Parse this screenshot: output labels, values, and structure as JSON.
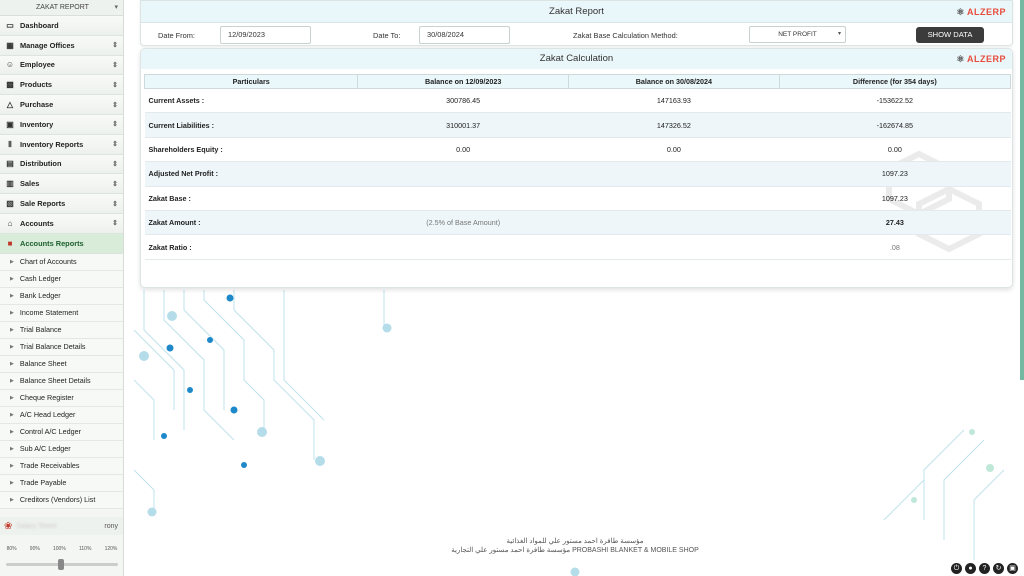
{
  "sidebar": {
    "title": "ZAKAT REPORT",
    "menu": [
      {
        "label": "Dashboard",
        "icon": "monitor-icon",
        "glyph": "▭",
        "arrow": ""
      },
      {
        "label": "Manage Offices",
        "icon": "building-icon",
        "glyph": "▦",
        "arrow": "⇕"
      },
      {
        "label": "Employee",
        "icon": "users-icon",
        "glyph": "☺",
        "arrow": "⇕"
      },
      {
        "label": "Products",
        "icon": "grid-icon",
        "glyph": "▩",
        "arrow": "⇕"
      },
      {
        "label": "Purchase",
        "icon": "cart-icon",
        "glyph": "△",
        "arrow": "⇕"
      },
      {
        "label": "Inventory",
        "icon": "box-icon",
        "glyph": "▣",
        "arrow": "⇕"
      },
      {
        "label": "Inventory Reports",
        "icon": "bar-chart-icon",
        "glyph": "Ⅱ",
        "arrow": "⇕"
      },
      {
        "label": "Distribution",
        "icon": "book-icon",
        "glyph": "▤",
        "arrow": "⇕"
      },
      {
        "label": "Sales",
        "icon": "register-icon",
        "glyph": "▥",
        "arrow": "⇕"
      },
      {
        "label": "Sale Reports",
        "icon": "report-icon",
        "glyph": "▧",
        "arrow": "⇕"
      },
      {
        "label": "Accounts",
        "icon": "bank-icon",
        "glyph": "⌂",
        "arrow": "⇕"
      },
      {
        "label": "Accounts Reports",
        "icon": "accounts-report-icon",
        "glyph": "■",
        "arrow": ""
      }
    ],
    "submenu": [
      "Chart of Accounts",
      "Cash Ledger",
      "Bank Ledger",
      "Income Statement",
      "Trial Balance",
      "Trial Balance Details",
      "Balance Sheet",
      "Balance Sheet Details",
      "Cheque Register",
      "A/C Head Ledger",
      "Control A/C Ledger",
      "Sub A/C Ledger",
      "Trade Receivables",
      "Trade Payable",
      "Creditors (Vendors) List"
    ],
    "user_name": "Salary Sheet",
    "user_right": "rony",
    "zoom_levels": [
      "80%",
      "90%",
      "100%",
      "110%",
      "120%"
    ],
    "zoom_value": 100
  },
  "header": {
    "title": "Zakat Report",
    "brand": "ALZERP",
    "date_from_label": "Date From:",
    "date_from": "12/09/2023",
    "date_to_label": "Date To:",
    "date_to": "30/08/2024",
    "method_label": "Zakat Base Calculation Method:",
    "method_value": "NET PROFIT",
    "show_button": "SHOW DATA"
  },
  "calc": {
    "title": "Zakat Calculation",
    "columns": [
      "Particulars",
      "Balance on 12/09/2023",
      "Balance on 30/08/2024",
      "Difference (for 354 days)"
    ],
    "rows": [
      {
        "particular": "Current Assets :",
        "a": "300786.45",
        "b": "147163.93",
        "c": "-153622.52"
      },
      {
        "particular": "Current Liabilities :",
        "a": "310001.37",
        "b": "147326.52",
        "c": "-162674.85"
      },
      {
        "particular": "Shareholders Equity :",
        "a": "0.00",
        "b": "0.00",
        "c": "0.00"
      },
      {
        "particular": "Adjusted Net Profit :",
        "a": "",
        "b": "",
        "c": "1097.23"
      },
      {
        "particular": "Zakat Base :",
        "a": "",
        "b": "",
        "c": "1097.23"
      },
      {
        "particular": "Zakat Amount :",
        "a": "(2.5% of Base Amount)",
        "b": "",
        "c": "27.43"
      },
      {
        "particular": "Zakat Ratio :",
        "a": "",
        "b": "",
        "c": ".08"
      }
    ]
  },
  "footer": {
    "line1": "مؤسسة طافرة احمد مستور علي للمواد الغذائية",
    "line2": "مؤسسة طافرة احمد مستور علي التجارية PROBASHI BLANKET & MOBILE SHOP"
  },
  "colors": {
    "accent": "#e74c3c",
    "header_bg": "#e9f6fa",
    "button_bg": "#3b3b3b",
    "circuit": "#1e88c8"
  }
}
